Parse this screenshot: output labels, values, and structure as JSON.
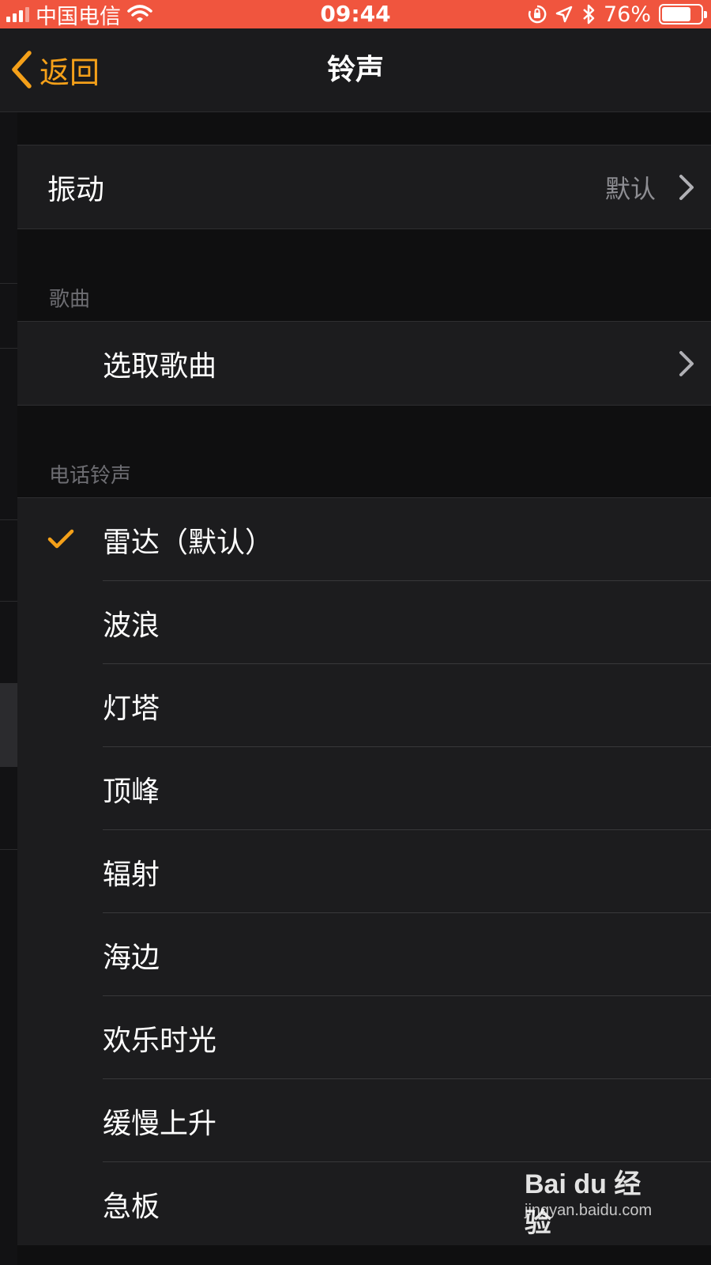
{
  "status_bar": {
    "carrier": "中国电信",
    "time": "09:44",
    "battery_percent": "76%",
    "battery_level": 0.76,
    "bg_color": "#f0553e",
    "icons": [
      "signal-icon",
      "wifi-icon",
      "orientation-lock-icon",
      "location-icon",
      "bluetooth-icon",
      "battery-icon"
    ]
  },
  "nav": {
    "back_label": "返回",
    "title": "铃声",
    "accent_color": "#f4a019"
  },
  "vibration": {
    "label": "振动",
    "value": "默认"
  },
  "songs": {
    "header": "歌曲",
    "pick_label": "选取歌曲"
  },
  "ringtones": {
    "header": "电话铃声",
    "items": [
      {
        "label": "雷达（默认）",
        "selected": true
      },
      {
        "label": "波浪",
        "selected": false
      },
      {
        "label": "灯塔",
        "selected": false
      },
      {
        "label": "顶峰",
        "selected": false
      },
      {
        "label": "辐射",
        "selected": false
      },
      {
        "label": "海边",
        "selected": false
      },
      {
        "label": "欢乐时光",
        "selected": false
      },
      {
        "label": "缓慢上升",
        "selected": false
      },
      {
        "label": "急板",
        "selected": false
      }
    ]
  },
  "watermark": {
    "logo": "Bai du 经验",
    "url": "jingyan.baidu.com"
  }
}
